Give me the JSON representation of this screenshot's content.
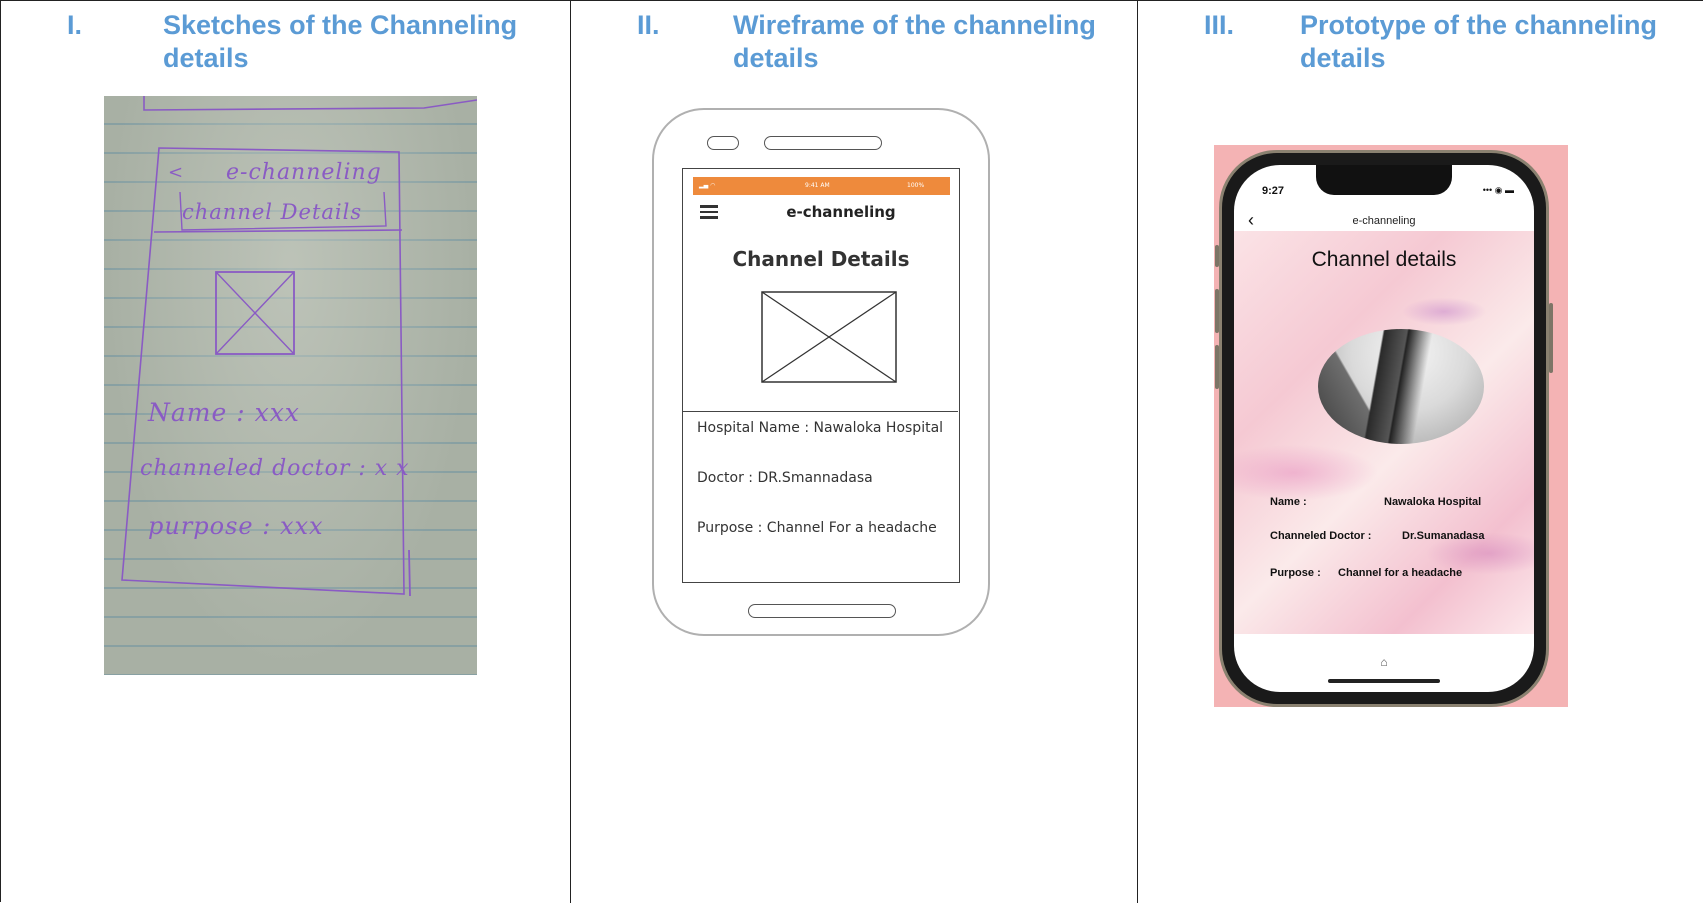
{
  "columns": [
    {
      "numeral": "I.",
      "title": "Sketches of the Channeling details"
    },
    {
      "numeral": "II.",
      "title": "Wireframe of the channeling details"
    },
    {
      "numeral": "III.",
      "title": "Prototype of the channeling details"
    }
  ],
  "sketch": {
    "back": "<",
    "app_title": "e-channeling",
    "screen_title": "channel Details",
    "name_line": "Name : xxx",
    "doctor_line": "channeled doctor : x x",
    "purpose_line": "purpose : xxx"
  },
  "wireframe": {
    "status_time": "9:41 AM",
    "status_battery": "100%",
    "app_title": "e-channeling",
    "screen_title": "Channel Details",
    "hospital_line": "Hospital Name : Nawaloka Hospital",
    "doctor_line": "Doctor : DR.Smannadasa",
    "purpose_line": "Purpose : Channel For a headache"
  },
  "prototype": {
    "time": "9:27",
    "status_icons": "••• ◉ ▬",
    "back": "‹",
    "app_title": "e-channeling",
    "screen_title": "Channel details",
    "name_label": "Name :",
    "name_value": "Nawaloka Hospital",
    "doctor_label": "Channeled Doctor :",
    "doctor_value": "Dr.Sumanadasa",
    "purpose_label": "Purpose :",
    "purpose_value": "Channel for a headache",
    "home_icon": "⌂"
  },
  "colors": {
    "heading": "#5b9bd5",
    "wire_status": "#ee8a3c",
    "proto_bg": "#f4b3b4",
    "ink": "#8a5bc4"
  }
}
